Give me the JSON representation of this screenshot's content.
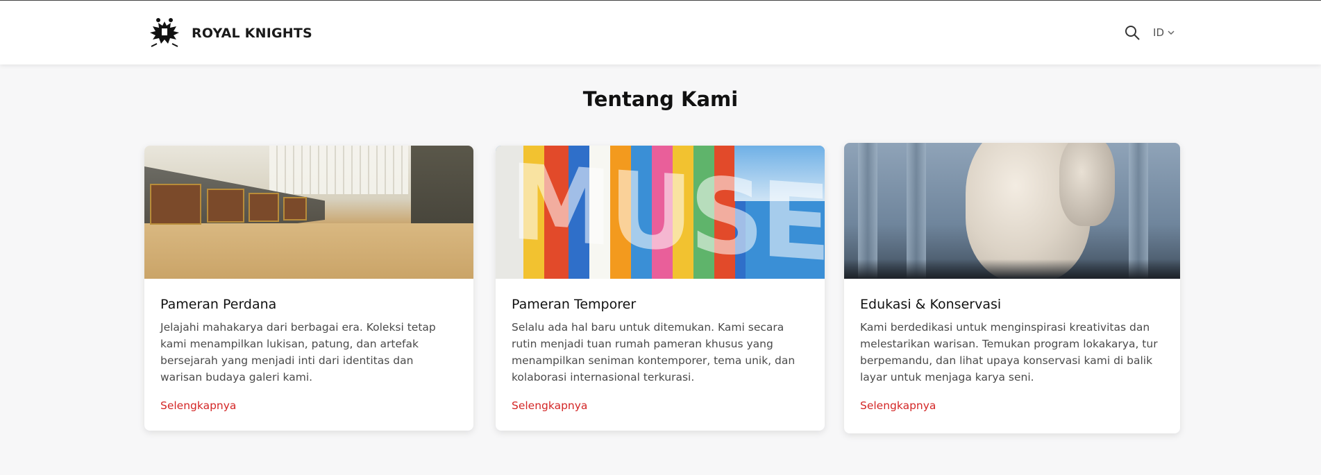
{
  "header": {
    "brand_name": "ROYAL KNIGHTS",
    "language": "ID"
  },
  "main": {
    "title": "Tentang Kami",
    "cards": [
      {
        "title": "Pameran Perdana",
        "description": "Jelajahi mahakarya dari berbagai era. Koleksi tetap kami menampilkan lukisan, patung, dan artefak bersejarah yang menjadi inti dari identitas dan warisan budaya galeri kami.",
        "link": "Selengkapnya"
      },
      {
        "title": "Pameran Temporer",
        "description": "Selalu ada hal baru untuk ditemukan. Kami secara rutin menjadi tuan rumah pameran khusus yang menampilkan seniman kontemporer, tema unik, dan kolaborasi internasional terkurasi.",
        "link": "Selengkapnya"
      },
      {
        "title": "Edukasi & Konservasi",
        "description": "Kami berdedikasi untuk menginspirasi kreativitas dan melestarikan warisan. Temukan program lokakarya, tur berpemandu, dan lihat upaya konservasi kami di balik layar untuk menjaga karya seni.",
        "link": "Selengkapnya"
      }
    ]
  },
  "colors": {
    "accent": "#d32626",
    "background": "#f7f7f8"
  }
}
